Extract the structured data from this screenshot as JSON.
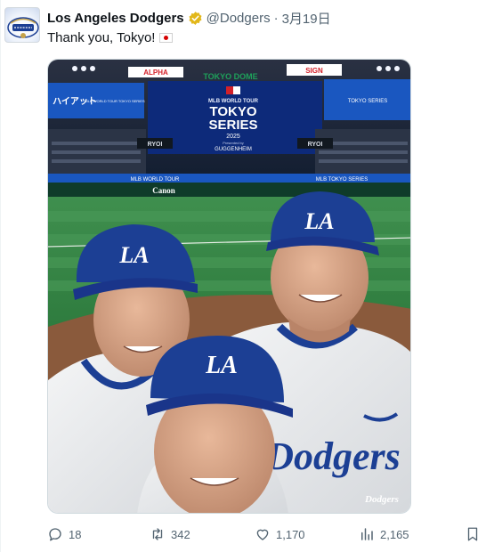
{
  "tweet": {
    "display_name": "Los Angeles Dodgers",
    "handle": "@Dodgers",
    "separator": "·",
    "date": "3月19日",
    "text": "Thank you, Tokyo!",
    "emoji_icon": "japan-flag-icon",
    "verified_icon": "gold-verified-badge-icon",
    "avatar_icon": "world-champions-logo-icon"
  },
  "media": {
    "stadium_signs": {
      "center_title": "TOKYO DOME",
      "scoreboard_line1": "MLB WORLD TOUR",
      "scoreboard_line2": "TOKYO",
      "scoreboard_line3": "SERIES",
      "scoreboard_year": "2025",
      "scoreboard_presented": "Presented by",
      "scoreboard_sponsor": "GUGGENHEIM",
      "left_sign": "ハイアット",
      "left_sign2": "MLB WORLD TOUR TOKYO SERIES",
      "ribbon_left": "MLB WORLD TOUR",
      "ribbon_right": "MLB TOKYO SERIES",
      "canon": "Canon",
      "ryoi": "RYOI",
      "dodgers_script": "Dodgers"
    },
    "cap_logo": "LA"
  },
  "actions": {
    "replies": "18",
    "retweets": "342",
    "likes": "1,170",
    "views": "2,165"
  },
  "colors": {
    "dodger_blue": "#1c3f94",
    "verified_gold": "#e2b719",
    "text_secondary": "#536471"
  }
}
